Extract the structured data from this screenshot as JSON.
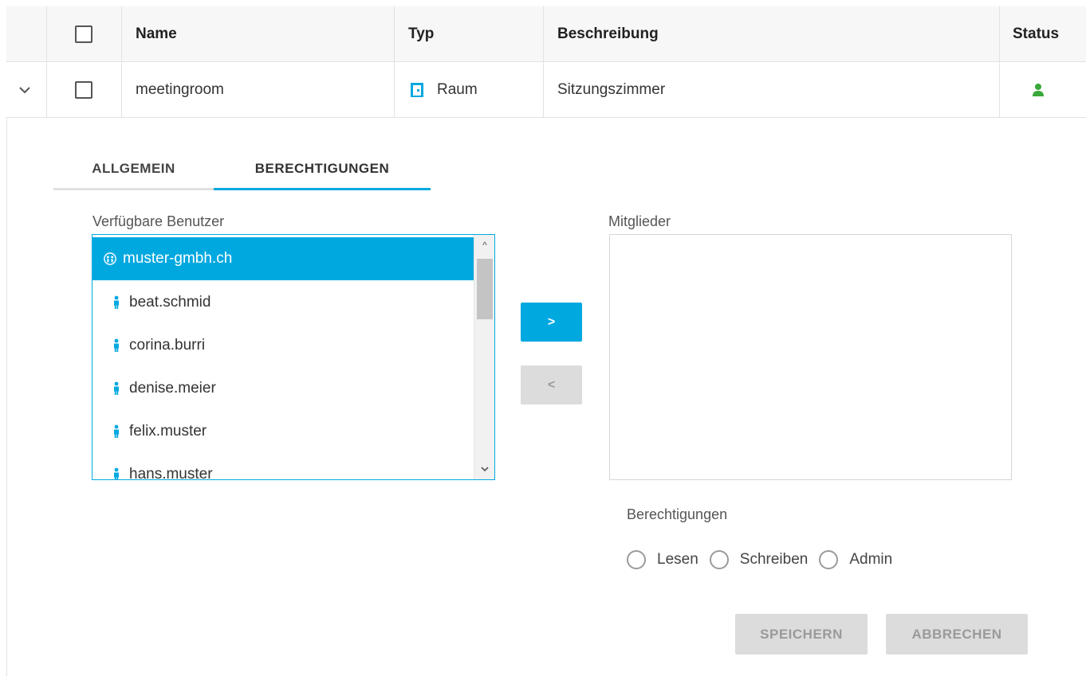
{
  "table": {
    "columns": [
      "Name",
      "Typ",
      "Beschreibung",
      "Status"
    ],
    "rows": [
      {
        "name": "meetingroom",
        "type": "Raum",
        "description": "Sitzungszimmer",
        "status_color": "#3aa83a"
      }
    ]
  },
  "details": {
    "tabs": [
      {
        "label": "ALLGEMEIN",
        "active": false
      },
      {
        "label": "BERECHTIGUNGEN",
        "active": true
      }
    ],
    "available_label": "Verfügbare Benutzer",
    "available_users": [
      {
        "label": "muster-gmbh.ch",
        "icon": "group-icon",
        "selected": true
      },
      {
        "label": "beat.schmid",
        "icon": "user-icon",
        "selected": false
      },
      {
        "label": "corina.burri",
        "icon": "user-icon",
        "selected": false
      },
      {
        "label": "denise.meier",
        "icon": "user-icon",
        "selected": false
      },
      {
        "label": "felix.muster",
        "icon": "user-icon",
        "selected": false
      },
      {
        "label": "hans.muster",
        "icon": "user-icon",
        "selected": false
      }
    ],
    "add_button": ">",
    "remove_button": "<",
    "members_label": "Mitglieder",
    "permissions_label": "Berechtigungen",
    "permissions": [
      "Lesen",
      "Schreiben",
      "Admin"
    ],
    "save_button": "SPEICHERN",
    "cancel_button": "ABBRECHEN"
  },
  "colors": {
    "accent": "#00a8e0",
    "status_active": "#3aa83a",
    "disabled_button": "#dcdcdc"
  }
}
